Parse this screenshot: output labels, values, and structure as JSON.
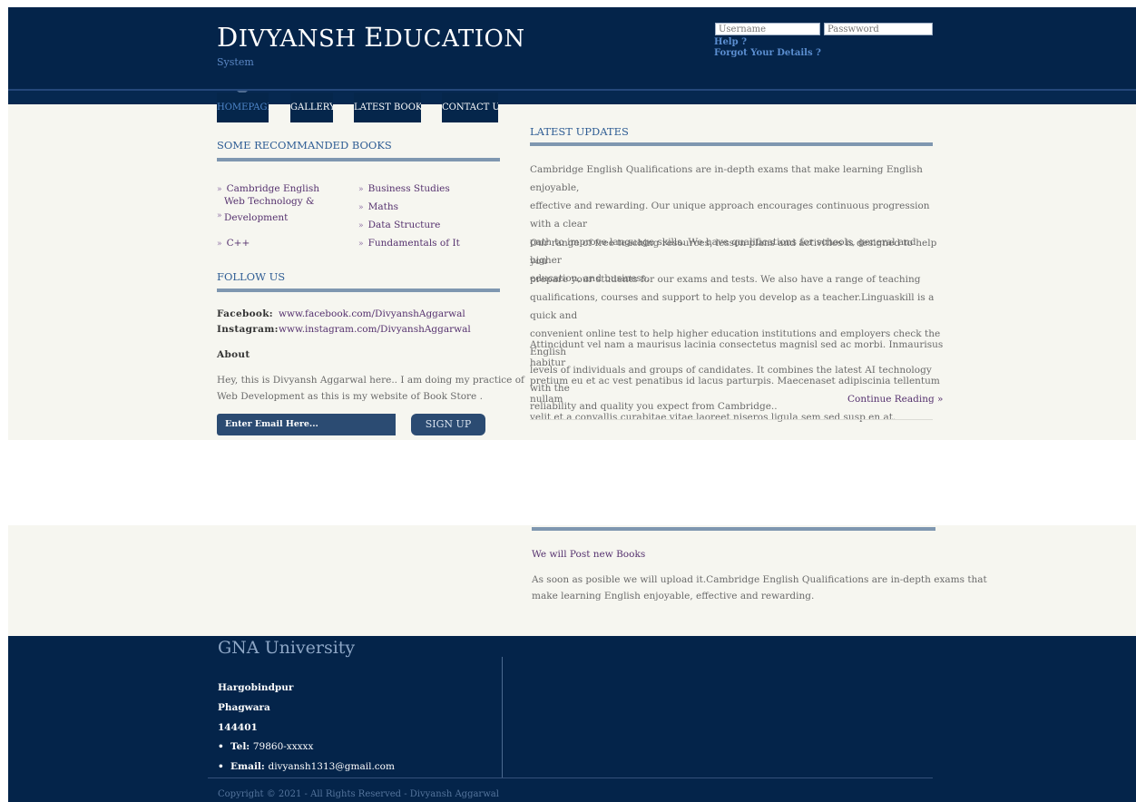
{
  "header": {
    "brand_first": "D",
    "brand_rest": "IVYANSH ",
    "brand_second": "E",
    "brand_second_rest": "DUCATION",
    "subtitle": "System",
    "username_placeholder": "Username",
    "password_placeholder": "Passwword",
    "help_link": "Help ?",
    "forgot_link": "Forgot Your Details ?"
  },
  "nav": {
    "items": [
      "HOMEPAGE",
      "GALLERY",
      "LATEST BOOKS",
      "CONTACT US"
    ],
    "active": "HOMEPAGE"
  },
  "books": {
    "title": "SOME RECOMMANDED BOOKS",
    "left": [
      "Cambridge English",
      "Web Technology &",
      "Development",
      "C++"
    ],
    "right": [
      "Business Studies",
      "Maths",
      "Data Structure",
      "Fundamentals of It"
    ],
    "bullet": "»"
  },
  "follow": {
    "title": "FOLLOW US",
    "facebook_label": "Facebook:",
    "facebook_value": "www.facebook.com/DivyanshAggarwal",
    "instagram_label": "Instagram:",
    "instagram_value": "www.instagram.com/DivyanshAggarwal",
    "about_label": "About",
    "about_line1": "Hey, this is Divyansh Aggarwal here.. I am doing my practice of",
    "about_line2": "Web Development as this is my website of Book Store .",
    "email_placeholder": "Enter Email Here...",
    "signup_label": "SIGN UP"
  },
  "updates": {
    "title": "LATEST UPDATES",
    "p1": [
      "Cambridge English Qualifications are in-depth exams that make learning English enjoyable,",
      "effective and rewarding. Our unique approach encourages continuous progression with a clear",
      "path to improve language skills. We have qualifications for schools, general and higher",
      "education, and business."
    ],
    "p2": [
      "Our range of free teaching resources, lesson plans and activities is designed to help you",
      "prepare your students for our exams and tests. We also have a range of teaching",
      "qualifications, courses and support to help you develop as a teacher.Linguaskill is a quick and",
      "convenient online test to help higher education institutions and employers check the English",
      "levels of individuals and groups of candidates. It combines the latest AI technology with the",
      "reliability and quality you expect from Cambridge.."
    ],
    "p3": [
      "Attincidunt vel nam a maurisus lacinia consectetus magnisl sed ac morbi. Inmaurisus habitur",
      "pretium eu et ac vest penatibus id lacus parturpis. Maecenaset adipiscinia tellentum nullam",
      "velit et a convallis curabitae vitae laoreet niseros ligula sem sed susp en at."
    ],
    "continue": "Continue Reading »"
  },
  "post": {
    "title": "We will Post new Books",
    "line1": "As soon as posible we will upload it.Cambridge English Qualifications are in-depth exams that",
    "line2": "make learning English enjoyable, effective and rewarding."
  },
  "footer": {
    "title": "GNA University",
    "addr1": "Hargobindpur",
    "addr2": "Phagwara",
    "addr3": "144401",
    "tel_label": "Tel:",
    "tel_value": "79860-xxxxx",
    "email_label": "Email:",
    "email_value": "divyansh1313@gmail.com",
    "bullet": "•",
    "copyright": "Copyright © 2021 - All Rights Reserved - Divyansh Aggarwal"
  }
}
